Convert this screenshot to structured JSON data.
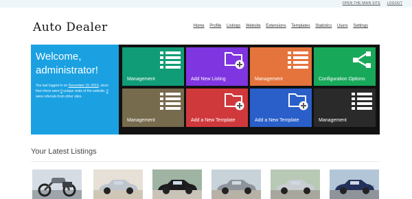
{
  "topbar": {
    "open_main_site": "OPEN THE MAIN SITE",
    "logout": "LOGOUT"
  },
  "brand": "Auto Dealer",
  "nav": [
    "Home",
    "Profile",
    "Listings",
    "Website",
    "Extensions",
    "Templates",
    "Statistics",
    "Users",
    "Settings"
  ],
  "welcome": {
    "title_line1": "Welcome,",
    "title_line2": "administrator!",
    "text_prefix": "You last logged in on ",
    "last_login": "December 19, 2013",
    "text_mid1": ", since then there were ",
    "unique_visits": "0",
    "text_mid2": " unique visits of the website, ",
    "referrals": "0",
    "text_suffix": " were referrals from other sites."
  },
  "tiles": [
    {
      "label": "Management",
      "color": "#109c76",
      "icon": "list-icon"
    },
    {
      "label": "Add New Listing",
      "color": "#7f35e0",
      "icon": "folder-add-icon"
    },
    {
      "label": "Management",
      "color": "#e5743c",
      "icon": "list-icon"
    },
    {
      "label": "Configuration Options",
      "color": "#18a85a",
      "icon": "share-icon"
    },
    {
      "label": "Management",
      "color": "#776b4e",
      "icon": "list-icon"
    },
    {
      "label": "Add a New Template",
      "color": "#d0393c",
      "icon": "folder-add-icon"
    },
    {
      "label": "Add a New Template",
      "color": "#2a5fc9",
      "icon": "folder-add-icon"
    },
    {
      "label": "Management",
      "color": "#2a2a2a",
      "icon": "list-icon"
    }
  ],
  "latest": {
    "title": "Your Latest Listings",
    "next_icon": "chevron-right-icon",
    "items": [
      {
        "name": "listing-motorcycle",
        "icon": "motorcycle-icon"
      },
      {
        "name": "listing-silver-coupe",
        "icon": "car-icon"
      },
      {
        "name": "listing-black-suv",
        "icon": "car-icon"
      },
      {
        "name": "listing-gray-sedan",
        "icon": "car-icon"
      },
      {
        "name": "listing-silver-sedan",
        "icon": "car-icon"
      },
      {
        "name": "listing-blue-sedan",
        "icon": "car-icon"
      },
      {
        "name": "listing-black-coupe",
        "icon": "car-icon"
      }
    ]
  }
}
